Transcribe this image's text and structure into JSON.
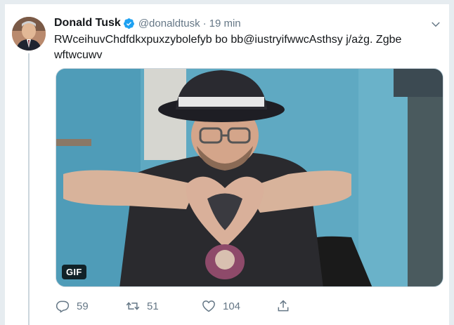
{
  "tweet": {
    "author_name": "Donald Tusk",
    "handle": "@donaldtusk",
    "separator": "·",
    "time": "19 min",
    "text": "RWceihuvChdfdkxpuxzybolefyb bo bb@iustryifwwcAsthsy j/ażg. Zgbe wftwcuwv",
    "media_badge": "GIF"
  },
  "actions": {
    "reply_count": "59",
    "retweet_count": "51",
    "like_count": "104"
  },
  "colors": {
    "verified": "#1da1f2",
    "secondary_text": "#657786",
    "thread_line": "#ccd6dd"
  },
  "icons": [
    "verified-badge-icon",
    "chevron-down-icon",
    "reply-icon",
    "retweet-icon",
    "like-icon",
    "share-icon"
  ]
}
